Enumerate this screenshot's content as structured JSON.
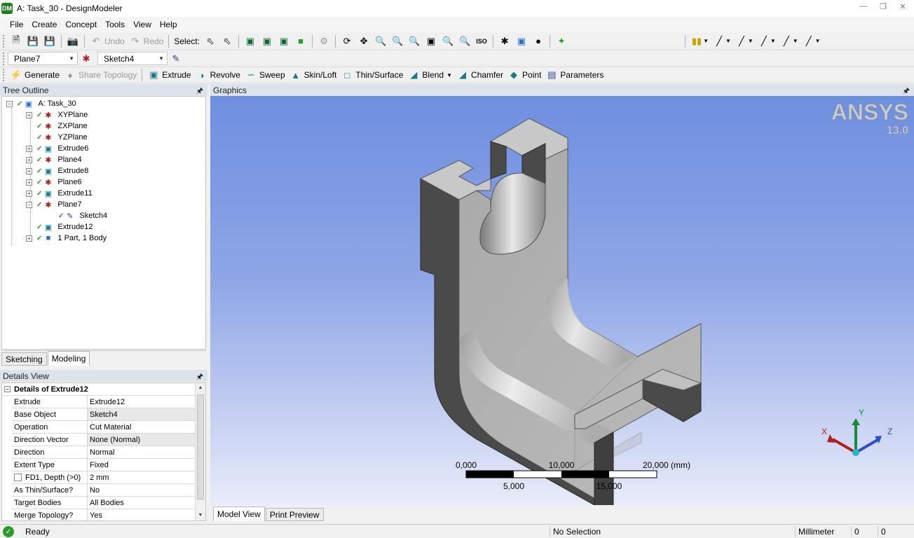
{
  "window": {
    "title": "A: Task_30 - DesignModeler",
    "app_icon_text": "DM"
  },
  "menu": [
    "File",
    "Create",
    "Concept",
    "Tools",
    "View",
    "Help"
  ],
  "toolbar1": {
    "undo_label": "Undo",
    "redo_label": "Redo",
    "select_label": "Select:"
  },
  "toolbar2": {
    "plane_select": "Plane7",
    "sketch_select": "Sketch4"
  },
  "toolbar3": {
    "generate": "Generate",
    "share_topology": "Share Topology",
    "extrude": "Extrude",
    "revolve": "Revolve",
    "sweep": "Sweep",
    "skin_loft": "Skin/Loft",
    "thin_surface": "Thin/Surface",
    "blend": "Blend",
    "chamfer": "Chamfer",
    "point": "Point",
    "parameters": "Parameters"
  },
  "tree": {
    "header": "Tree Outline",
    "root": "A: Task_30",
    "items": [
      {
        "label": "XYPlane"
      },
      {
        "label": "ZXPlane"
      },
      {
        "label": "YZPlane"
      },
      {
        "label": "Extrude6"
      },
      {
        "label": "Plane4"
      },
      {
        "label": "Extrude8"
      },
      {
        "label": "Plane6"
      },
      {
        "label": "Extrude11"
      },
      {
        "label": "Plane7"
      },
      {
        "label": "Sketch4"
      },
      {
        "label": "Extrude12"
      },
      {
        "label": "1 Part, 1 Body"
      }
    ]
  },
  "left_tabs": {
    "sketching": "Sketching",
    "modeling": "Modeling"
  },
  "details": {
    "header": "Details View",
    "section": "Details of Extrude12",
    "rows": [
      {
        "key": "Extrude",
        "value": "Extrude12"
      },
      {
        "key": "Base Object",
        "value": "Sketch4"
      },
      {
        "key": "Operation",
        "value": "Cut Material"
      },
      {
        "key": "Direction Vector",
        "value": "None (Normal)"
      },
      {
        "key": "Direction",
        "value": "Normal"
      },
      {
        "key": "Extent Type",
        "value": "Fixed"
      },
      {
        "key": "FD1, Depth (>0)",
        "value": "2 mm"
      },
      {
        "key": "As Thin/Surface?",
        "value": "No"
      },
      {
        "key": "Target Bodies",
        "value": "All Bodies"
      },
      {
        "key": "Merge Topology?",
        "value": "Yes"
      }
    ]
  },
  "graphics": {
    "header": "Graphics",
    "brand": "ANSYS",
    "version": "13.0",
    "scale_top": [
      "0,000",
      "10,000",
      "20,000 (mm)"
    ],
    "scale_bottom": [
      "5,000",
      "15,000"
    ],
    "axis_labels": {
      "x": "X",
      "y": "Y",
      "z": "Z"
    }
  },
  "view_tabs": {
    "model_view": "Model View",
    "print_preview": "Print Preview"
  },
  "status": {
    "ready": "Ready",
    "selection": "No Selection",
    "units": "Millimeter",
    "v1": "0",
    "v2": "0"
  },
  "colors": {
    "accent": "#1e7f1e",
    "viewport_top": "#6e8fe0",
    "viewport_bottom": "#e8ecfa"
  }
}
